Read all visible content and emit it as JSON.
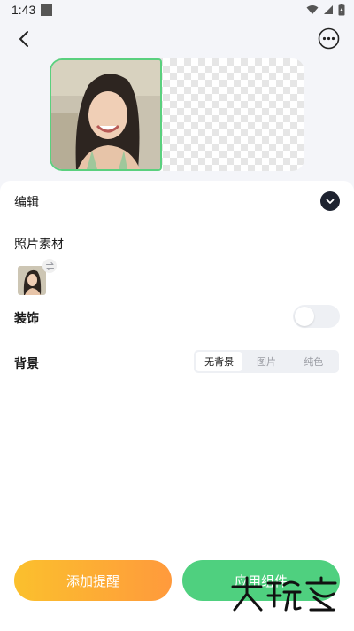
{
  "status_bar": {
    "time": "1:43"
  },
  "icons": {
    "back": "chevron-left-icon",
    "more": "more-horizontal-icon",
    "edit_toggle": "chevron-down-icon",
    "swap": "swap-icon",
    "wifi": "wifi-icon",
    "signal": "signal-icon",
    "battery": "battery-icon"
  },
  "edit_section": {
    "title": "编辑"
  },
  "photo_material": {
    "title": "照片素材"
  },
  "decoration": {
    "title": "装饰",
    "enabled": false
  },
  "background": {
    "title": "背景",
    "options": [
      "无背景",
      "图片",
      "纯色"
    ],
    "selected": "无背景"
  },
  "actions": {
    "add_reminder": "添加提醒",
    "apply_widget": "应用组件"
  },
  "watermark": {
    "text": "大玩客"
  },
  "colors": {
    "accent_green": "#4fd07f",
    "orange_start": "#fbc02d",
    "orange_end": "#ff9a3c",
    "dark": "#1e2330"
  }
}
